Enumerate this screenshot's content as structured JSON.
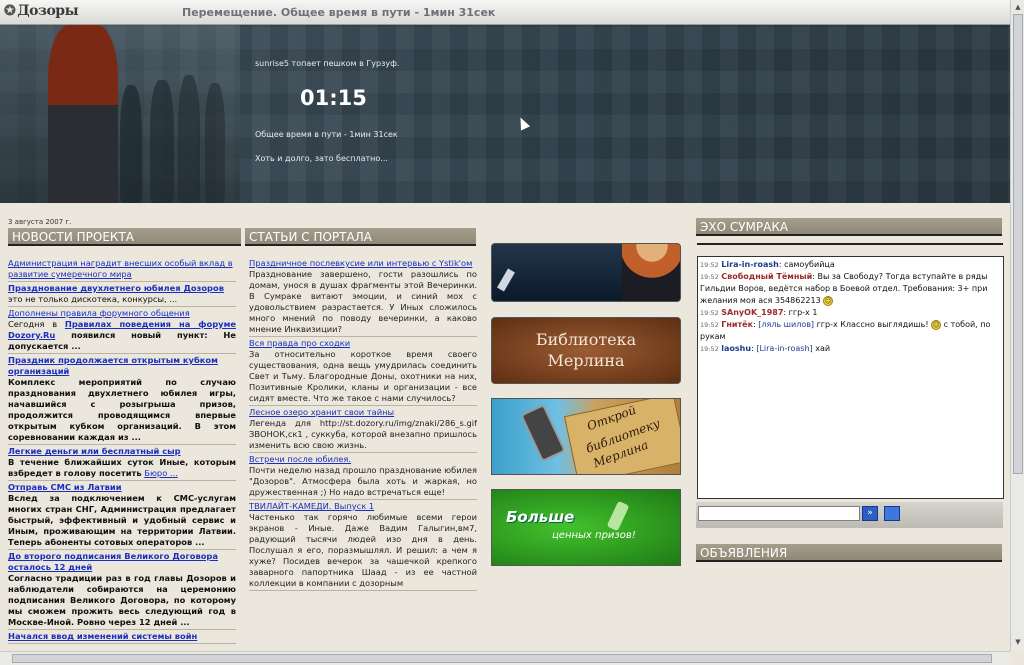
{
  "header": {
    "logo": "Дозоры",
    "trip_title": "Перемещение. Общее время в пути - 1мин 31сек"
  },
  "hero": {
    "walk": "sunrise5 топает пешком в Гурзуф.",
    "clock": "01:15",
    "total": "Общее время в пути - 1мин 31сек",
    "note": "Хоть и долго, зато бесплатно..."
  },
  "date": "3 августа 2007 г.",
  "news": {
    "head": "НОВОСТИ ПРОЕКТА",
    "items": [
      {
        "title": "Администрация наградит внесших особый вклад в развитие сумеречного мира",
        "body": ""
      },
      {
        "title": "Празднование двухлетнего юбилея Дозоров",
        "body": "это не только дискотека, конкурсы, ..."
      },
      {
        "title": "Дополнены правила форумного общения",
        "body": ""
      }
    ],
    "rules_prefix": "Сегодня в",
    "rules_link": "Правилах поведения на форуме Dozory.Ru",
    "rules_suffix": " появился новый пункт: Не допускается ...",
    "items2": [
      {
        "title": "Праздник продолжается открытым кубком организаций",
        "body": "Комплекс мероприятий по случаю празднования двухлетнего юбилея игры, начавшийся с розыгрыша призов, продолжится проводящимся впервые открытым кубком организаций. В этом соревновании каждая из ..."
      },
      {
        "title": "Легкие деньги или бесплатный сыр",
        "body": "В течение ближайших суток Иные, которым взбредет в голову посетить"
      },
      {
        "title": "Отправь СМС из Латвии",
        "body": "Вслед за подключением к СМС-услугам многих стран СНГ, Администрация предлагает быстрый, эффективный и удобный сервис и Иным, проживающим на территории Латвии. Теперь абоненты сотовых операторов ..."
      },
      {
        "title": "До второго подписания Великого Договора осталось 12 дней",
        "body": "Согласно традиции раз в год главы Дозоров и наблюдатели собираются на церемонию подписания Великого Договора, по которому мы сможем прожить весь следующий год в Москве-Иной. Ровно через 12 дней ..."
      },
      {
        "title": "Начался ввод изменений системы войн",
        "body": ""
      }
    ],
    "bureau_link": "Бюро ..."
  },
  "articles": {
    "head": "СТАТЬИ С ПОРТАЛА",
    "items": [
      {
        "title": "Праздничное послевкусие или интервью с Ystik'ом",
        "body": "Празднование завершено, гости разошлись по домам, унося в душах фрагменты этой Вечеринки. В Сумраке витают эмоции, и синий мох с удовольствием разрастается. У Иных сложилось много мнений по поводу вечеринки, а каково мнение Инквизиции?"
      },
      {
        "title": "Вся правда про сходки",
        "body": "За относительно короткое время своего существования, одна вещь умудрилась соединить Свет и Тьму. Благородные Доны, охотники на них, Позитивные Кролики, кланы и организации - все сидят вместе. Что же такое с нами случилось?"
      },
      {
        "title": "Лесное озеро хранит свои тайны",
        "body": "Легенда для http://st.dozory.ru/img/znaki/286_s.gif ЗВОНОК,ск1 , суккуба, которой внезапно пришлось изменить всю свою жизнь."
      },
      {
        "title": "Встречи после юбилея.",
        "body": "Почти неделю назад прошло празднование юбилея \"Дозоров\". Атмосфера была хоть и жаркая, но дружественная ;) Но надо встречаться еще!"
      },
      {
        "title": "ТВИЛАЙТ-КАМЕДИ. Выпуск 1",
        "body": "Частенько так горячо любимые всеми герои экранов - Иные. Даже Вадим Галыгин,вм7, радующий тысячи людей изо дня в день. Послушал я его, поразмышлял. И решил: а чем я хуже? Посидев вечерок за чашечкой крепкого заварного папортника Шаад - из ее частной коллекции в компании с дозорным"
      }
    ]
  },
  "banners": {
    "library_line1": "Библиотека",
    "library_line2": "Мерлина",
    "open_line1": "Открой",
    "open_line2": "библиотеку",
    "open_line3": "Мерлина",
    "prizes_line1": "Больше",
    "prizes_line2": "ценных призов!"
  },
  "echo": {
    "head": "ЭХО СУМРАКА",
    "messages": [
      {
        "time": "19:52",
        "nick": "Lira-in-roash",
        "to": "",
        "text": "самоубийца"
      },
      {
        "time": "19:52",
        "nick": "Свободный Тёмный",
        "to": "",
        "text": "Вы за Свободу? Тогда вступайте в ряды Гильдии Воров, ведётся набор в Боевой отдел. Требования: 3+ при желания моя ася 354862213"
      },
      {
        "time": "19:52",
        "nick": "SAnyOK_1987",
        "to": "",
        "text": "ггр-х 1"
      },
      {
        "time": "19:52",
        "nick": "Гнитёк",
        "to": "[ляль шилов]",
        "text": "ггр-х Классно выглядишь!",
        "tail": "с тобой, по рукам"
      },
      {
        "time": "19:52",
        "nick": "laoshu",
        "to": "[Lira-in-roash]",
        "text": "хай"
      }
    ],
    "send_symbol": "»"
  },
  "ads": {
    "head": "ОБЪЯВЛЕНИЯ"
  }
}
